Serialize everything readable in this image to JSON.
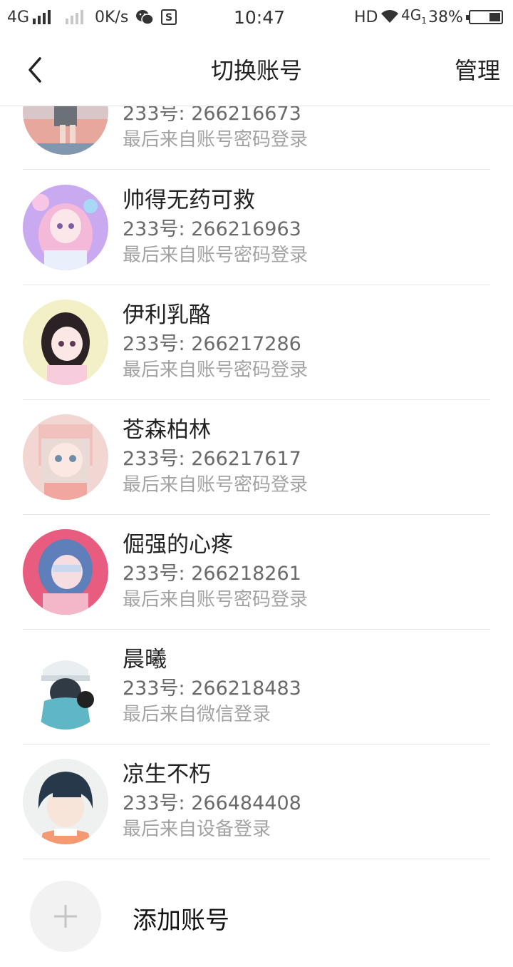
{
  "status_bar": {
    "network1": "4G",
    "speed": "0K/s",
    "time": "10:47",
    "hd": "HD",
    "network2": "4G",
    "network2_sub": "1",
    "battery": "38%",
    "battery_level": 0.38
  },
  "header": {
    "title": "切换账号",
    "manage_label": "管理"
  },
  "accounts": [
    {
      "name": "",
      "uid": "233号: 266216673",
      "login_method": "最后来自账号密码登录"
    },
    {
      "name": "帅得无药可救",
      "uid": "233号: 266216963",
      "login_method": "最后来自账号密码登录"
    },
    {
      "name": "伊利乳酪",
      "uid": "233号: 266217286",
      "login_method": "最后来自账号密码登录"
    },
    {
      "name": "苍森柏林",
      "uid": "233号: 266217617",
      "login_method": "最后来自账号密码登录"
    },
    {
      "name": "倔强的心疼",
      "uid": "233号: 266218261",
      "login_method": "最后来自账号密码登录"
    },
    {
      "name": "晨曦",
      "uid": "233号: 266218483",
      "login_method": "最后来自微信登录"
    },
    {
      "name": "凉生不朽",
      "uid": "233号: 266484408",
      "login_method": "最后来自设备登录"
    }
  ],
  "add_account": {
    "label": "添加账号"
  }
}
